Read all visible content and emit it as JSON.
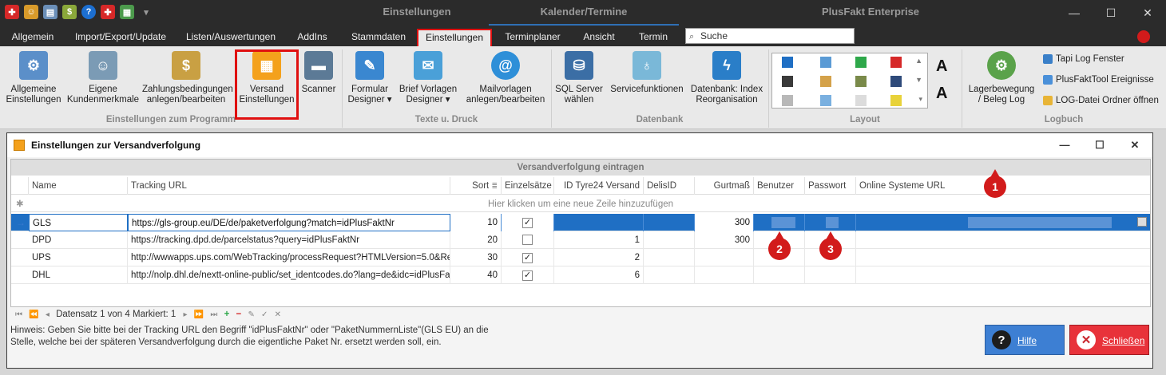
{
  "titlebar": {
    "context_tab_1": "Einstellungen",
    "context_tab_2": "Kalender/Termine",
    "app_title": "PlusFakt Enterprise",
    "minimize": "—",
    "maximize": "☐",
    "close": "✕"
  },
  "menu": {
    "items": [
      "Allgemein",
      "Import/Export/Update",
      "Listen/Auswertungen",
      "AddIns",
      "Stammdaten",
      "Einstellungen",
      "Terminplaner",
      "Ansicht",
      "Termin"
    ],
    "active": "Einstellungen",
    "search_placeholder": "Suche"
  },
  "ribbon": {
    "buttons": {
      "allgemeine": "Allgemeine\nEinstellungen",
      "kundenmerkmale": "Eigene\nKundenmerkmale",
      "zahlung": "Zahlungsbedingungen\nanlegen/bearbeiten",
      "versand": "Versand\nEinstellungen",
      "scanner": "Scanner",
      "formular": "Formular\nDesigner ▾",
      "brief": "Brief Vorlagen\nDesigner ▾",
      "mail": "Mailvorlagen\nanlegen/bearbeiten",
      "sql": "SQL Server\nwählen",
      "service": "Servicefunktionen",
      "reorg": "Datenbank: Index\nReorganisation",
      "lager": "Lagerbewegung\n/ Beleg Log"
    },
    "groups": {
      "programm": "Einstellungen zum Programm",
      "texte": "Texte u. Druck",
      "datenbank": "Datenbank",
      "layout": "Layout",
      "logbuch": "Logbuch"
    },
    "log_items": [
      "Tapi Log Fenster",
      "PlusFaktTool Ereignisse",
      "LOG-Datei Ordner öffnen"
    ]
  },
  "dialog": {
    "title": "Einstellungen zur Versandverfolgung",
    "group_header": "Versandverfolgung eintragen",
    "columns": [
      "Name",
      "Tracking URL",
      "Sort",
      "Einzelsätze",
      "ID Tyre24 Versand",
      "DelisID",
      "Gurtmaß",
      "Benutzer",
      "Passwort",
      "Online Systeme URL"
    ],
    "new_row_hint": "Hier klicken um eine neue Zeile hinzuzufügen",
    "rows": [
      {
        "name": "GLS",
        "url": "https://gls-group.eu/DE/de/paketverfolgung?match=idPlusFaktNr",
        "sort": "10",
        "einzel": true,
        "tyre": "",
        "delis": "",
        "gurt": "300"
      },
      {
        "name": "DPD",
        "url": "https://tracking.dpd.de/parcelstatus?query=idPlusFaktNr",
        "sort": "20",
        "einzel": false,
        "tyre": "1",
        "delis": "",
        "gurt": "300"
      },
      {
        "name": "UPS",
        "url": "http://wwwapps.ups.com/WebTracking/processRequest?HTMLVersion=5.0&Re...",
        "sort": "30",
        "einzel": true,
        "tyre": "2",
        "delis": "",
        "gurt": ""
      },
      {
        "name": "DHL",
        "url": "http://nolp.dhl.de/nextt-online-public/set_identcodes.do?lang=de&idc=idPlusFa...",
        "sort": "40",
        "einzel": true,
        "tyre": "6",
        "delis": "",
        "gurt": ""
      }
    ],
    "navigator": "Datensatz 1 von 4 Markiert: 1",
    "hint": "Hinweis:  Geben Sie bitte bei der Tracking URL den Begriff \"idPlusFaktNr\" oder \"PaketNummernListe\"(GLS EU) an die\nStelle, welche bei der späteren Versandverfolgung durch die eigentliche Paket Nr. ersetzt werden soll, ein.",
    "help_button": "Hilfe",
    "close_button": "Schließen"
  },
  "markers": [
    "1",
    "2",
    "3"
  ],
  "colors": {
    "accent": "#1f6fc4",
    "highlight": "#e01010",
    "marker": "#d21b1b"
  }
}
